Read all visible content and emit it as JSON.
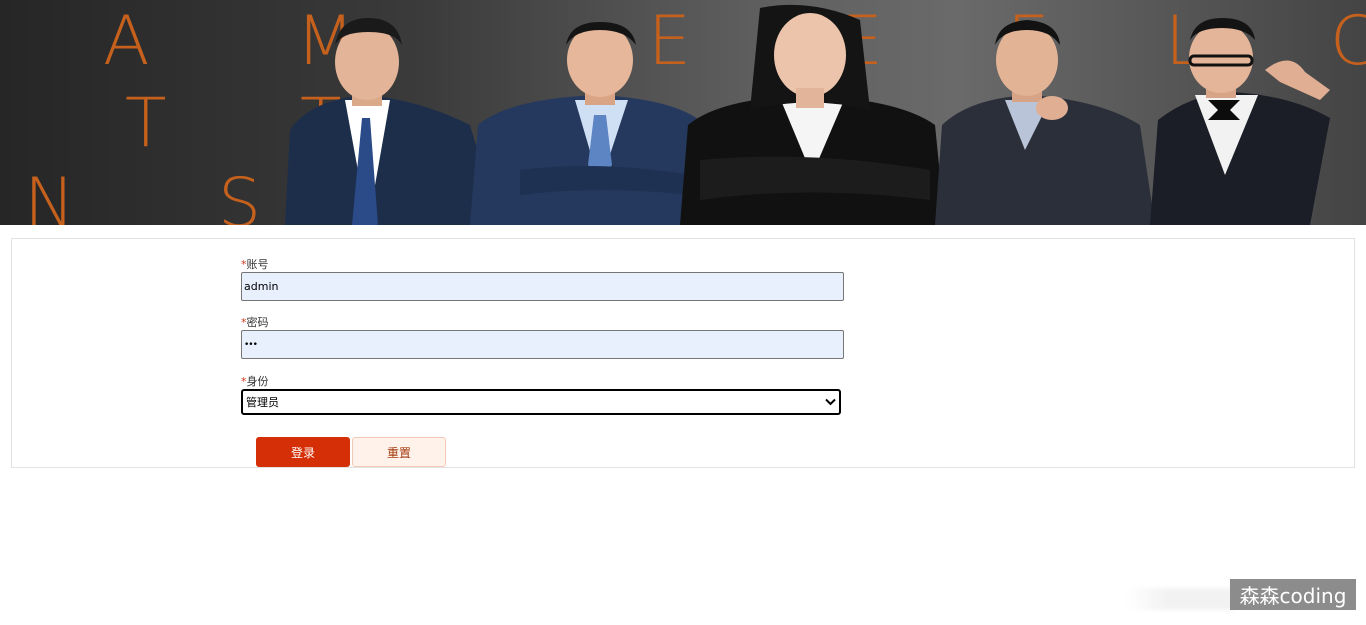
{
  "banner": {
    "letters": [
      "A",
      "M",
      "E",
      "E",
      "E",
      "L",
      "C",
      "T",
      "T",
      "N",
      "S"
    ]
  },
  "form": {
    "account": {
      "required_mark": "*",
      "label": "账号",
      "value": "admin"
    },
    "password": {
      "required_mark": "*",
      "label": "密码",
      "value": "•••"
    },
    "role": {
      "required_mark": "*",
      "label": "身份",
      "selected": "管理员"
    },
    "login_label": "登录",
    "reset_label": "重置"
  },
  "watermark": {
    "text": "森森coding"
  },
  "colors": {
    "primary": "#d42f06",
    "reset_bg": "#fff2ea",
    "input_bg": "#e8f0fe",
    "banner_letter": "#c5611d"
  }
}
